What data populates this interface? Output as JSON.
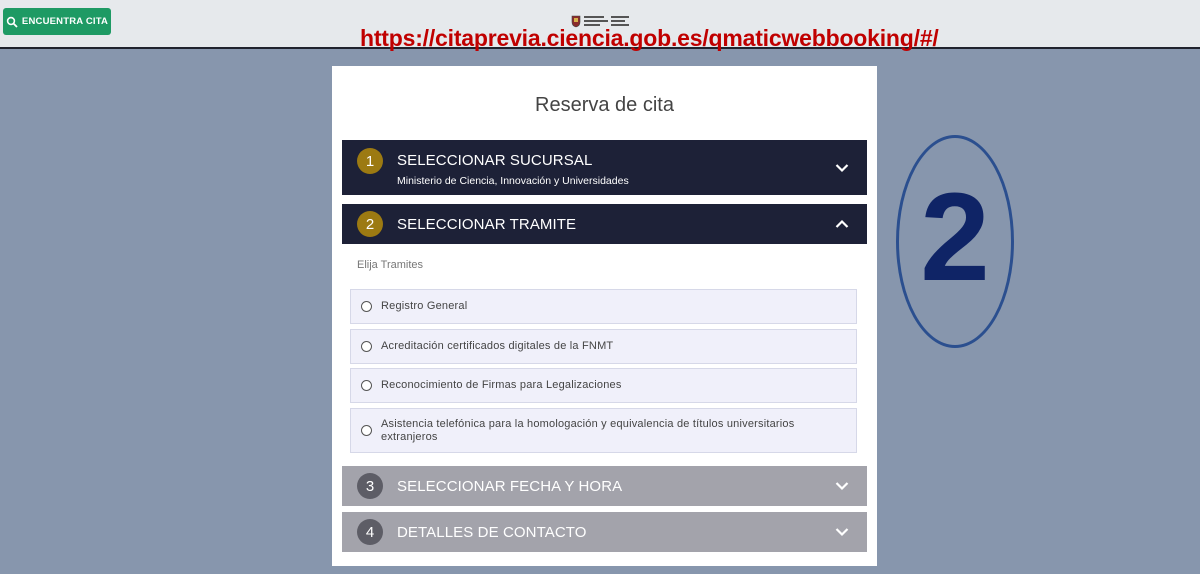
{
  "header": {
    "find_button_label": "ENCUENTRA CITA",
    "url_annotation": "https://citaprevia.ciencia.gob.es/qmaticwebbooking/#/"
  },
  "card": {
    "title": "Reserva de cita",
    "steps": [
      {
        "number": "1",
        "title": "SELECCIONAR SUCURSAL",
        "subtitle": "Ministerio de Ciencia, Innovación y Universidades",
        "state": "collapsed"
      },
      {
        "number": "2",
        "title": "SELECCIONAR TRAMITE",
        "state": "expanded"
      },
      {
        "number": "3",
        "title": "SELECCIONAR FECHA Y HORA",
        "state": "disabled"
      },
      {
        "number": "4",
        "title": "DETALLES DE CONTACTO",
        "state": "disabled"
      }
    ],
    "tramite_hint": "Elija Tramites",
    "tramite_options": [
      "Registro General",
      "Acreditación certificados digitales de la FNMT",
      "Reconocimiento de Firmas para Legalizaciones",
      "Asistencia telefónica para la homologación y equivalencia de títulos universitarios extranjeros"
    ]
  },
  "annotation": {
    "step_marker": "2"
  },
  "colors": {
    "background": "#8796ad",
    "header_bg": "#e6e9ec",
    "find_button": "#1e9a64",
    "active_step_bg": "#1d2137",
    "active_step_badge": "#9c7a12",
    "disabled_step_bg": "#a3a3ab",
    "url_annotation": "#c00000",
    "marker_color": "#0f2466"
  },
  "icons": {
    "find_button": "search-icon",
    "collapsed_step": "chevron-down-icon",
    "expanded_step": "chevron-up-icon"
  }
}
